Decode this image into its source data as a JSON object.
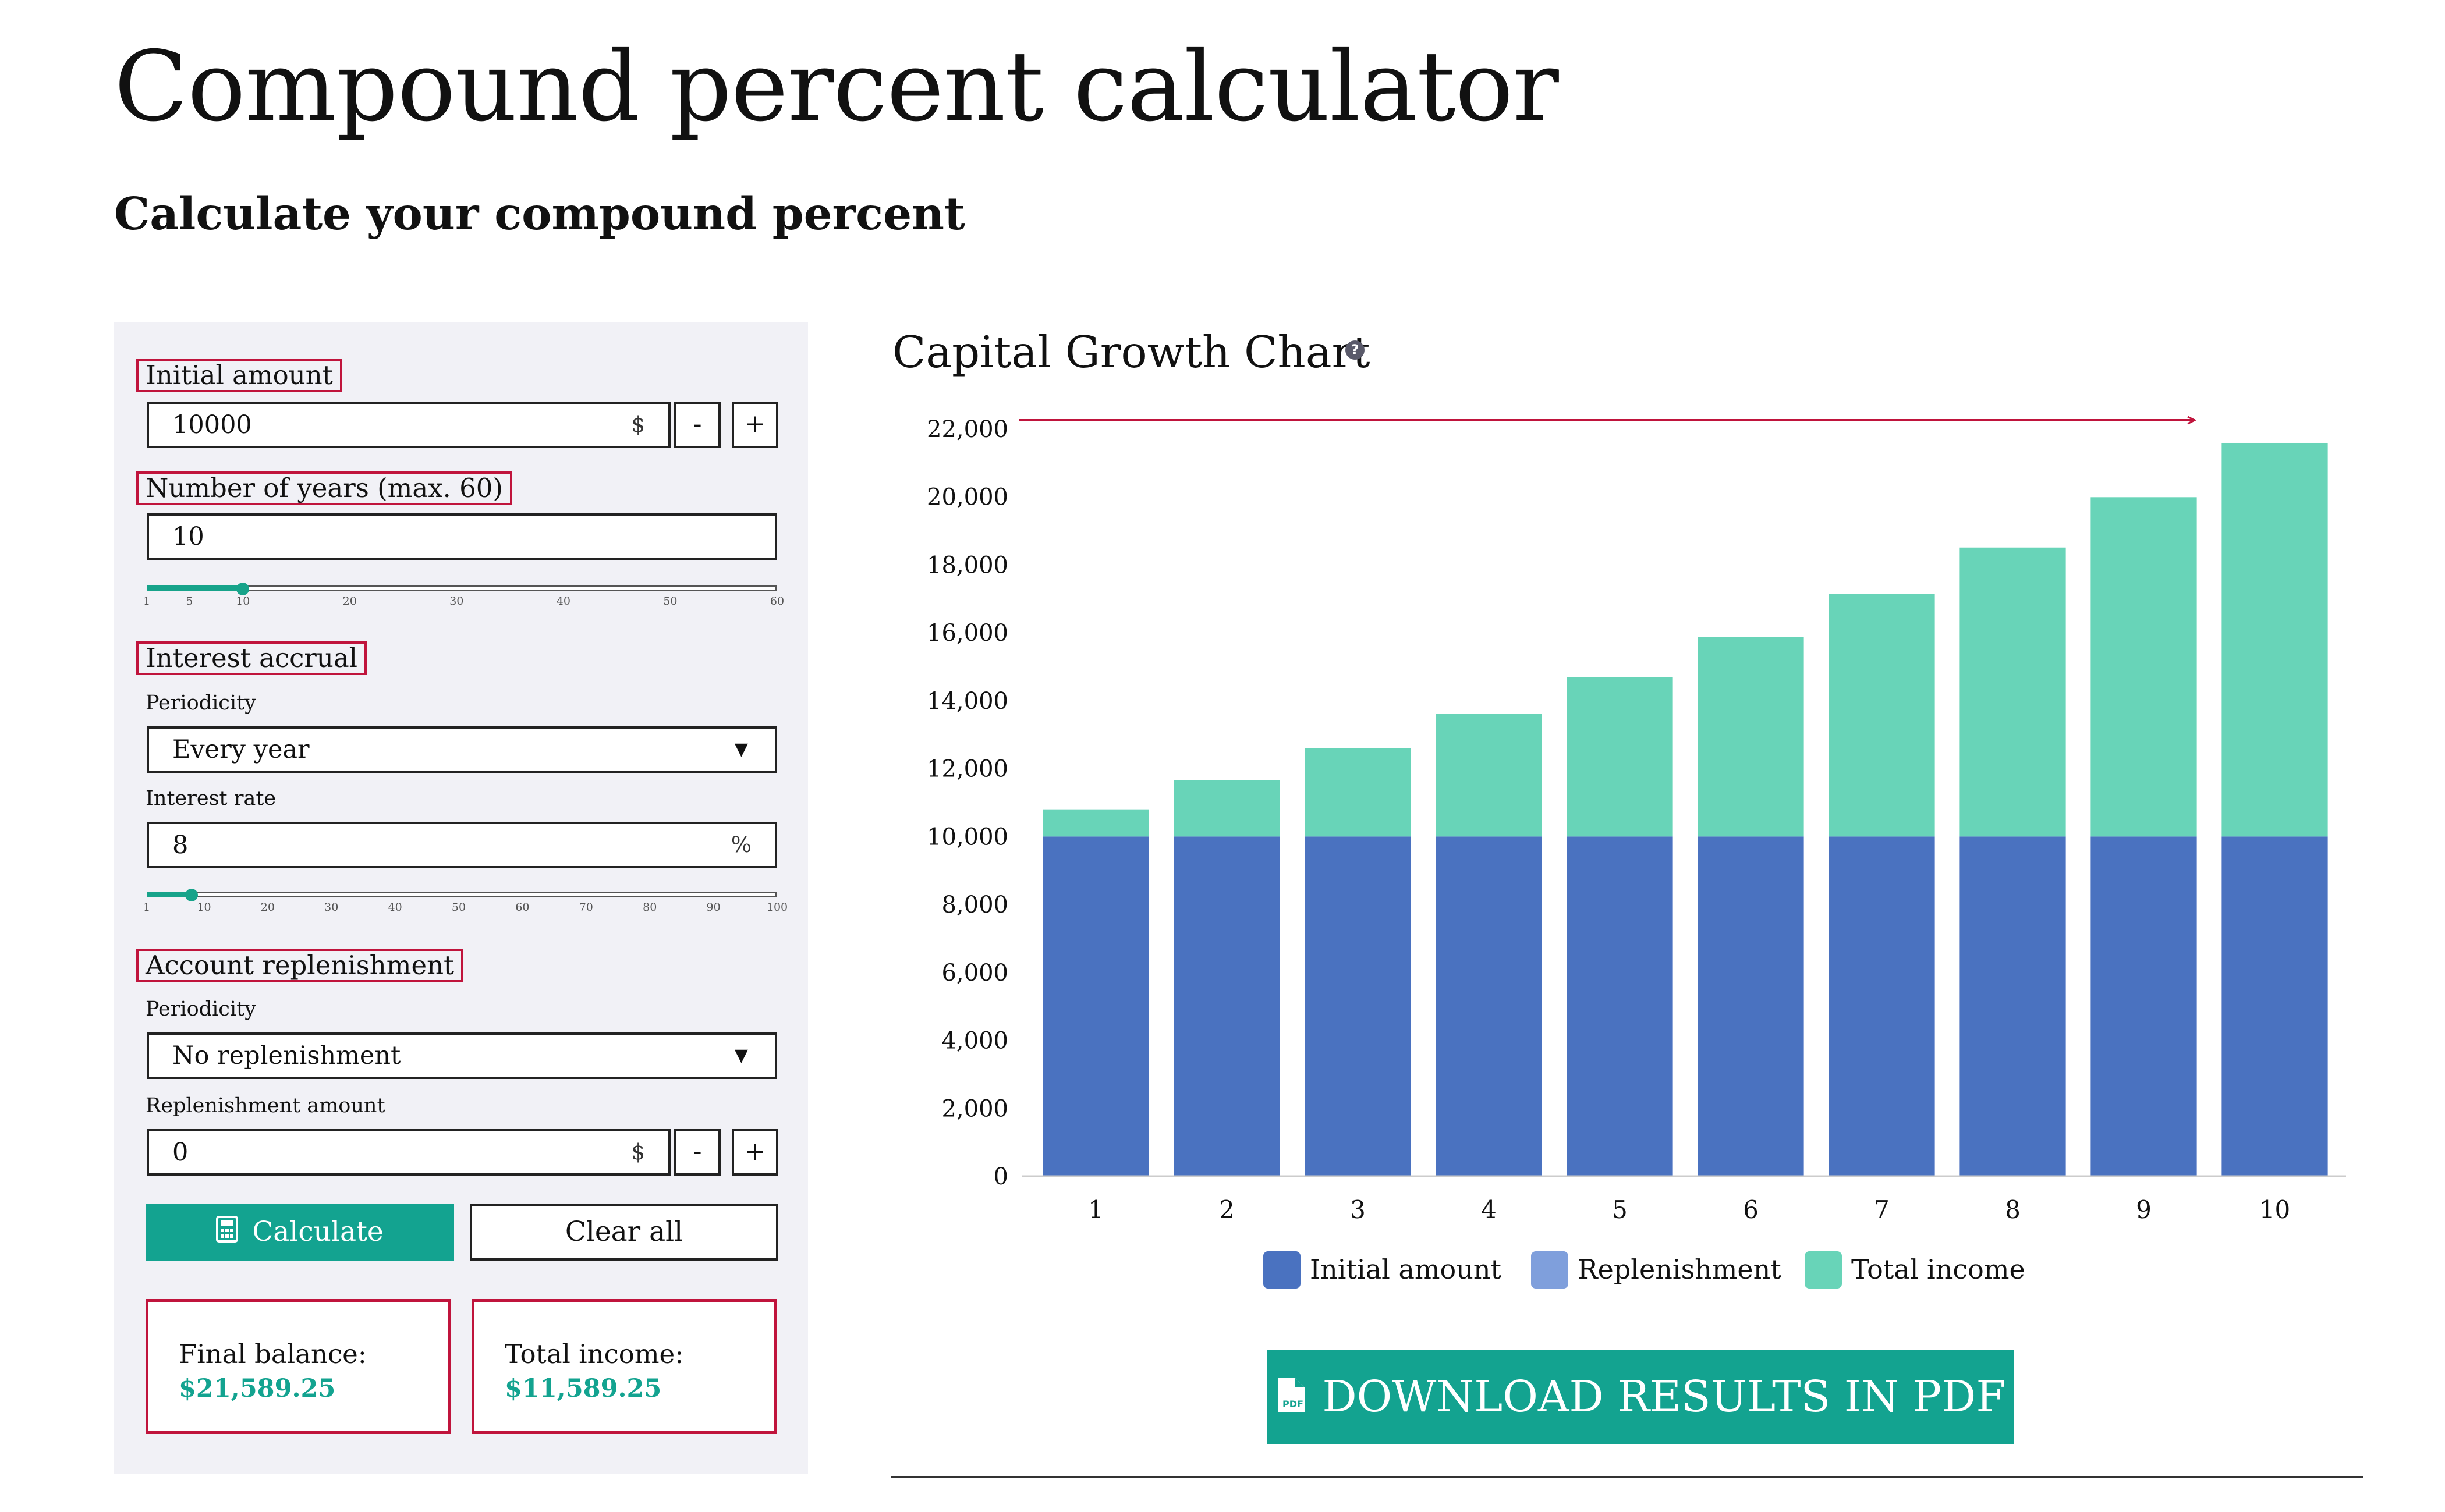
{
  "header": {
    "title": "Compound percent calculator",
    "subtitle": "Calculate your compound percent"
  },
  "form": {
    "initial_amount": {
      "label": "Initial amount",
      "value": "10000",
      "unit": "$",
      "minus": "-",
      "plus": "+"
    },
    "years": {
      "label": "Number of years (max. 60)",
      "value": "10",
      "slider": {
        "min": 1,
        "max": 60,
        "current": 10,
        "ticks": [
          "1",
          "5",
          "10",
          "20",
          "30",
          "40",
          "50",
          "60"
        ]
      }
    },
    "interest": {
      "label": "Interest accrual",
      "periodicity_label": "Periodicity",
      "periodicity_value": "Every year",
      "rate_label": "Interest rate",
      "rate_value": "8",
      "rate_unit": "%",
      "slider": {
        "min": 1,
        "max": 100,
        "current": 8,
        "ticks": [
          "1",
          "10",
          "20",
          "30",
          "40",
          "50",
          "60",
          "70",
          "80",
          "90",
          "100"
        ]
      }
    },
    "replenishment": {
      "label": "Account replenishment",
      "periodicity_label": "Periodicity",
      "periodicity_value": "No replenishment",
      "amount_label": "Replenishment amount",
      "amount_value": "0",
      "unit": "$",
      "minus": "-",
      "plus": "+"
    },
    "buttons": {
      "calculate": "Calculate",
      "clear": "Clear all"
    },
    "results": {
      "final_balance_label": "Final balance:",
      "final_balance_value": "$21,589.25",
      "total_income_label": "Total income:",
      "total_income_value": "$11,589.25"
    }
  },
  "chart": {
    "title": "Capital Growth Chart",
    "help_icon": "?",
    "download_label": "DOWNLOAD RESULTS IN PDF"
  },
  "colors": {
    "accent": "#13a390",
    "highlight": "#c0143c",
    "initial": "#4a72c0",
    "replenishment": "#7f9fdc",
    "income": "#68d4b8"
  },
  "icons": {
    "calculate": "calculator-icon",
    "download": "pdf-file-icon",
    "help": "question-circle-icon",
    "dropdown": "triangle-down-icon"
  },
  "chart_data": {
    "type": "bar",
    "stacked": true,
    "categories": [
      "1",
      "2",
      "3",
      "4",
      "5",
      "6",
      "7",
      "8",
      "9",
      "10"
    ],
    "series": [
      {
        "name": "Initial amount",
        "color": "#4a72c0",
        "values": [
          10000,
          10000,
          10000,
          10000,
          10000,
          10000,
          10000,
          10000,
          10000,
          10000
        ]
      },
      {
        "name": "Replenishment",
        "color": "#7f9fdc",
        "values": [
          0,
          0,
          0,
          0,
          0,
          0,
          0,
          0,
          0,
          0
        ]
      },
      {
        "name": "Total income",
        "color": "#68d4b8",
        "values": [
          800,
          1664,
          2597,
          3605,
          4693,
          5869,
          7138,
          8509,
          9990,
          11589
        ]
      }
    ],
    "ylim": [
      0,
      22000
    ],
    "yticks": [
      "0",
      "2,000",
      "4,000",
      "6,000",
      "8,000",
      "10,000",
      "12,000",
      "14,000",
      "16,000",
      "18,000",
      "20,000",
      "22,000"
    ],
    "ytick_values": [
      0,
      2000,
      4000,
      6000,
      8000,
      10000,
      12000,
      14000,
      16000,
      18000,
      20000,
      22000
    ],
    "grid": false,
    "legend": "bottom"
  }
}
